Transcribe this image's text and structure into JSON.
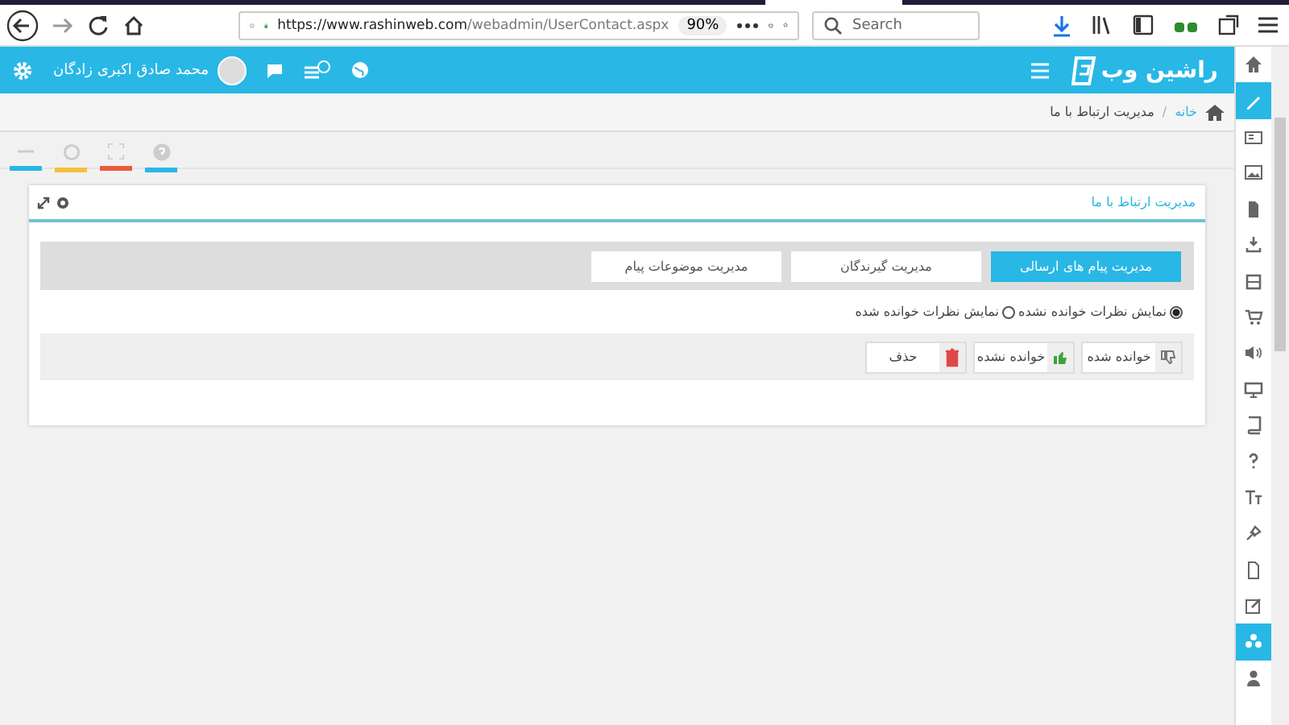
{
  "browser": {
    "url_host": "https://www.rashinweb.com",
    "url_path": "/webadmin/UserContact.aspx",
    "zoom": "90%",
    "search": {
      "placeholder": "Search"
    }
  },
  "header": {
    "logo": "راشین وب",
    "user_name": "محمد صادق اکبری زادگان"
  },
  "breadcrumb": {
    "home": "خانه",
    "separator": "/",
    "current": "مدیریت ارتباط با ما"
  },
  "sidebar": {
    "items": [
      {
        "selected": false
      },
      {
        "selected": true
      },
      {
        "selected": false
      },
      {
        "selected": false
      },
      {
        "selected": false
      },
      {
        "selected": false
      },
      {
        "selected": false
      },
      {
        "selected": false
      },
      {
        "selected": false
      },
      {
        "selected": false
      },
      {
        "selected": false
      },
      {
        "selected": false
      },
      {
        "selected": false
      },
      {
        "selected": false
      },
      {
        "selected": false
      },
      {
        "selected": false
      },
      {
        "selected": true
      },
      {
        "selected": false
      }
    ]
  },
  "panel": {
    "title": "مدیریت ارتباط با ما",
    "tabs": [
      {
        "label": "مدیریت پیام های ارسالی",
        "selected": true
      },
      {
        "label": "مدیریت گیرندگان",
        "selected": false
      },
      {
        "label": "مدیریت موضوعات پیام",
        "selected": false
      }
    ],
    "filters": [
      {
        "label": "نمایش نظرات خوانده نشده",
        "selected": true
      },
      {
        "label": "نمایش نظرات خوانده شده",
        "selected": false
      }
    ],
    "actions": [
      {
        "kind": "read",
        "label": "خوانده شده"
      },
      {
        "kind": "unread",
        "label": "خوانده نشده"
      },
      {
        "kind": "delete",
        "label": "حذف"
      }
    ]
  }
}
